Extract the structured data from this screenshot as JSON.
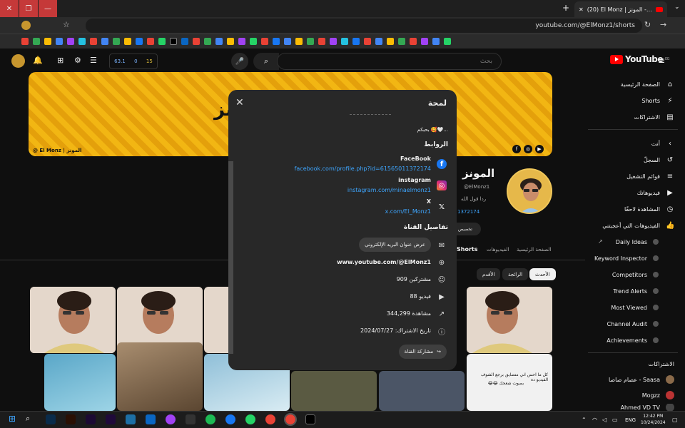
{
  "browser": {
    "tab_title": "(20) El Monz | المونز - YouTube",
    "url": "youtube.com/@ElMonz1/shorts",
    "new_tab_label": "+"
  },
  "yt": {
    "logo_text": "YouTube",
    "logo_region": "EG",
    "search_placeholder": "بحث",
    "stats": [
      "63.1",
      "0",
      "15"
    ]
  },
  "banner": {
    "title": "المونز",
    "tag": "@ El Monz | المونز"
  },
  "sidebar": {
    "main": [
      {
        "label": "الصفحة الرئيسية",
        "icon": "home-icon",
        "glyph": "⌂"
      },
      {
        "label": "Shorts",
        "icon": "shorts-icon",
        "glyph": "⚡"
      },
      {
        "label": "الاشتراكات",
        "icon": "subscriptions-icon",
        "glyph": "▤"
      }
    ],
    "you_header": "أنت",
    "you": [
      {
        "label": "السجلّ",
        "icon": "history-icon",
        "glyph": "↺"
      },
      {
        "label": "قوائم التشغيل",
        "icon": "playlist-icon",
        "glyph": "≡"
      },
      {
        "label": "فيديوهاتك",
        "icon": "your-videos-icon",
        "glyph": "▶"
      },
      {
        "label": "المشاهدة لاحقًا",
        "icon": "watch-later-icon",
        "glyph": "◷"
      },
      {
        "label": "الفيديوهات التي أعجبتني",
        "icon": "liked-icon",
        "glyph": "👍"
      }
    ],
    "tools": [
      "Daily Ideas",
      "Keyword Inspector",
      "Competitors",
      "Trend Alerts",
      "Most Viewed",
      "Channel Audit",
      "Achievements"
    ],
    "subs_header": "الاشتراكات",
    "subs": [
      "عصام صاصا - Saasa",
      "Mogzz",
      "Ahmed VD TV"
    ]
  },
  "channel": {
    "name_partial": "المونز",
    "handle_partial": "@ElMonz1",
    "desc_partial": "ردا قول الله",
    "link_partial": "1372174",
    "customize_label": "تخصيص",
    "tabs": [
      "الصفحة الرئيسية",
      "الفيديوهات",
      "Shorts"
    ],
    "chips": [
      "الأحدث",
      "الرائجة",
      "الأقدم"
    ]
  },
  "modal": {
    "title": "لمحة",
    "desc": "بحبكم 🥰🤍...",
    "links_header": "الروابط",
    "links": [
      {
        "name": "FaceBook",
        "url": "facebook.com/profile.php?id=61565011372174",
        "icon": "facebook-icon"
      },
      {
        "name": "instagram",
        "url": "instagram.com/minaelmonz1",
        "icon": "instagram-icon"
      },
      {
        "name": "X",
        "url": "x.com/El_Monz1",
        "icon": "x-icon"
      }
    ],
    "details_header": "تفاصيل القناة",
    "email_btn": "عرض عنوان البريد الإلكتروني",
    "channel_url": "www.youtube.com/@ElMonz1",
    "subscribers": "909 مشتركين",
    "videos": "88 فيديو",
    "views": "344,299 مشاهدة",
    "joined": "تاريخ الاشتراك: 2024/07/27",
    "share_btn": "مشاركة القناة"
  },
  "taskbar": {
    "lang": "ENG",
    "time": "12:42 PM",
    "date": "10/24/2024"
  },
  "thumb_captions": [
    "كل ما احس اني متضايق برجع الشوف الفيديو ده",
    "بصوت شعحك 😂😂"
  ]
}
